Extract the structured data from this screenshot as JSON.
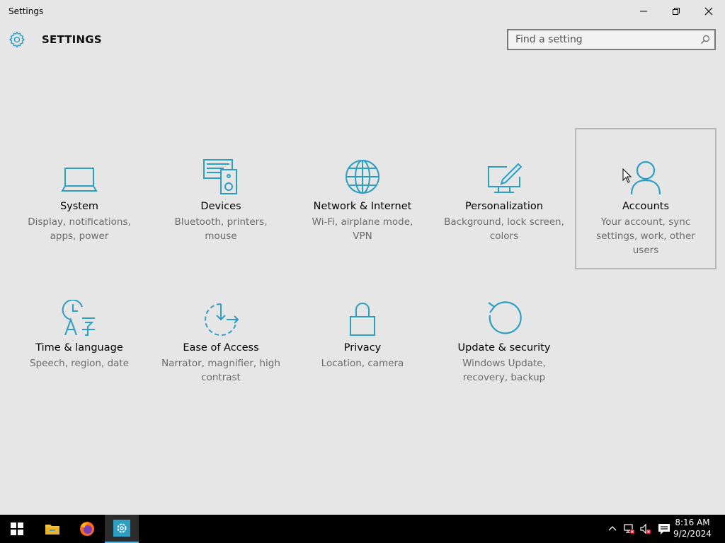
{
  "window": {
    "title": "Settings"
  },
  "header": {
    "title": "SETTINGS",
    "search_placeholder": "Find a setting"
  },
  "tiles": [
    {
      "name": "System",
      "desc": "Display, notifications, apps, power"
    },
    {
      "name": "Devices",
      "desc": "Bluetooth, printers, mouse"
    },
    {
      "name": "Network & Internet",
      "desc": "Wi-Fi, airplane mode, VPN"
    },
    {
      "name": "Personalization",
      "desc": "Background, lock screen, colors"
    },
    {
      "name": "Accounts",
      "desc": "Your account, sync settings, work, other users"
    },
    {
      "name": "Time & language",
      "desc": "Speech, region, date"
    },
    {
      "name": "Ease of Access",
      "desc": "Narrator, magnifier, high contrast"
    },
    {
      "name": "Privacy",
      "desc": "Location, camera"
    },
    {
      "name": "Update & security",
      "desc": "Windows Update, recovery, backup"
    }
  ],
  "taskbar": {
    "time": "8:16 AM",
    "date": "9/2/2024"
  },
  "colors": {
    "accent": "#2c9ec2",
    "background": "#e6e6e6",
    "taskbar": "#000000"
  }
}
